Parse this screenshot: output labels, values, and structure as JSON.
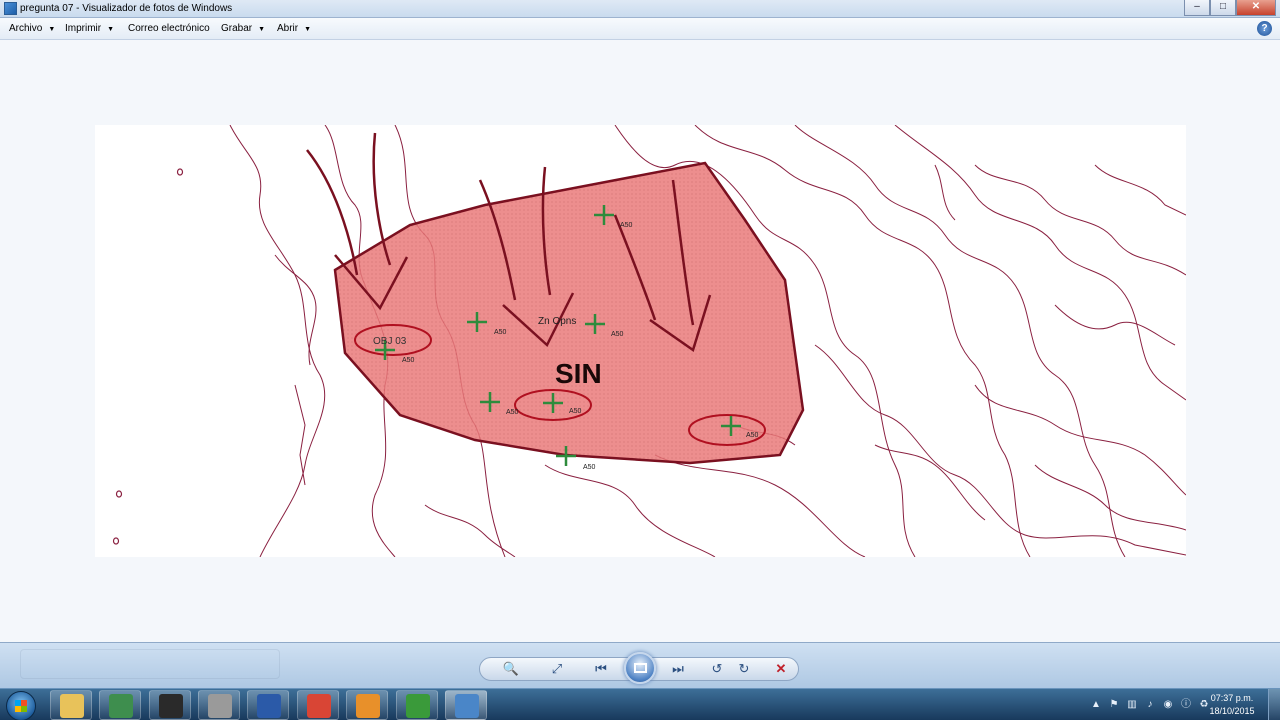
{
  "window": {
    "title": "pregunta 07 - Visualizador de fotos de Windows",
    "minimize_glyph": "–",
    "maximize_glyph": "□",
    "close_glyph": "✕"
  },
  "menu": {
    "items": [
      {
        "label": "Archivo",
        "arrow": "▼"
      },
      {
        "label": "Imprimir",
        "arrow": "▼"
      },
      {
        "label": "Correo electrónico",
        "arrow": ""
      },
      {
        "label": "Grabar",
        "arrow": "▼"
      },
      {
        "label": "Abrir",
        "arrow": "▼"
      }
    ],
    "help_glyph": "?"
  },
  "map": {
    "zone_label": "SIN",
    "zn_label": "Zn Opns",
    "objective_label": "OBJ 03",
    "unit_tag": "A50",
    "zone_fill": "#e87878",
    "zone_stroke": "#7a1020",
    "contour_color": "#8a2040",
    "marker_color": "#2e8b3c"
  },
  "controls": {
    "zoom_glyph": "🔍",
    "actual_size_glyph": "⤢",
    "prev_glyph": "⏮",
    "next_glyph": "⏭",
    "rotate_ccw_glyph": "↺",
    "rotate_cw_glyph": "↻",
    "delete_glyph": "✕"
  },
  "taskbar": {
    "apps": [
      {
        "name": "explorer",
        "icon": "folder-icon",
        "color": "#e8c25a"
      },
      {
        "name": "globe",
        "icon": "globe-icon",
        "color": "#3e8e4e"
      },
      {
        "name": "player",
        "icon": "media-321-icon",
        "color": "#2a2a2a"
      },
      {
        "name": "tool",
        "icon": "utility-icon",
        "color": "#9a9a9a"
      },
      {
        "name": "word",
        "icon": "word-icon",
        "color": "#2b5aa8"
      },
      {
        "name": "chrome",
        "icon": "chrome-icon",
        "color": "#d94535"
      },
      {
        "name": "media",
        "icon": "media-player-icon",
        "color": "#e8902a"
      },
      {
        "name": "camtasia",
        "icon": "camtasia-icon",
        "color": "#3a9a3a"
      },
      {
        "name": "photos",
        "icon": "photo-viewer-icon",
        "color": "#4a86c8"
      }
    ],
    "time": "07:37 p.m.",
    "date": "18/10/2015"
  }
}
